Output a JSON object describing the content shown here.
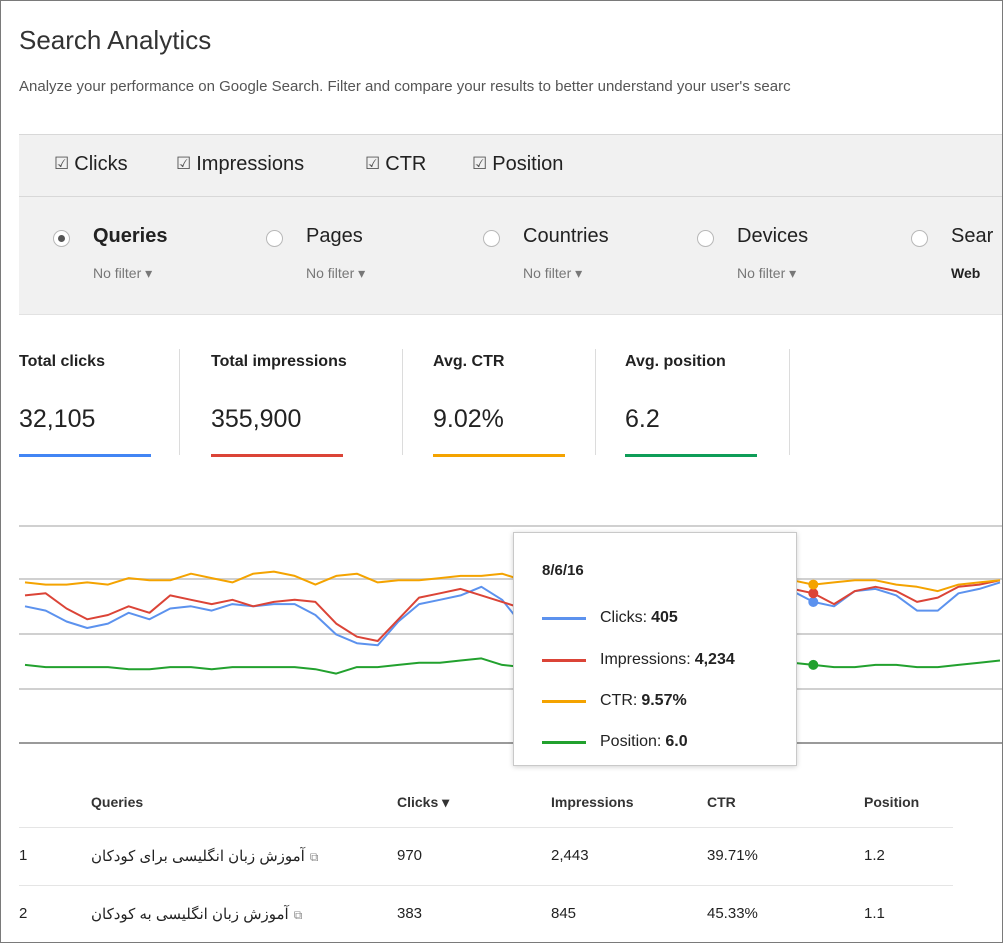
{
  "header": {
    "title": "Search Analytics",
    "description": "Analyze your performance on Google Search. Filter and compare your results to better understand your user's searc"
  },
  "metrics": [
    {
      "label": "Clicks",
      "checked": true
    },
    {
      "label": "Impressions",
      "checked": true
    },
    {
      "label": "CTR",
      "checked": true
    },
    {
      "label": "Position",
      "checked": true
    }
  ],
  "check_glyph": "☑",
  "groups": [
    {
      "label": "Queries",
      "filter": "No filter ▾",
      "selected": true
    },
    {
      "label": "Pages",
      "filter": "No filter ▾",
      "selected": false
    },
    {
      "label": "Countries",
      "filter": "No filter ▾",
      "selected": false
    },
    {
      "label": "Devices",
      "filter": "No filter ▾",
      "selected": false
    },
    {
      "label": "Sear",
      "filter": "Web",
      "selected": false
    }
  ],
  "totals": [
    {
      "label": "Total clicks",
      "value": "32,105",
      "color": "#4285f4"
    },
    {
      "label": "Total impressions",
      "value": "355,900",
      "color": "#db4437"
    },
    {
      "label": "Avg. CTR",
      "value": "9.02%",
      "color": "#f4a300"
    },
    {
      "label": "Avg. position",
      "value": "6.2",
      "color": "#0f9d58"
    }
  ],
  "chart_data": {
    "type": "line",
    "series": [
      {
        "name": "Clicks",
        "color": "#5c92ee",
        "values": [
          63,
          61,
          56,
          53,
          55,
          60,
          57,
          62,
          63,
          61,
          64,
          63,
          64,
          64,
          59,
          50,
          46,
          45,
          56,
          64,
          66,
          68,
          72,
          66,
          54,
          67,
          68,
          66,
          63,
          69,
          70,
          67,
          65,
          57,
          60,
          66,
          68,
          70,
          65,
          63,
          70,
          71,
          68,
          61,
          61,
          69,
          71,
          74
        ]
      },
      {
        "name": "Impressions",
        "color": "#db4437",
        "values": [
          68,
          69,
          62,
          57,
          59,
          63,
          60,
          68,
          66,
          64,
          66,
          63,
          65,
          66,
          65,
          55,
          49,
          47,
          57,
          67,
          69,
          71,
          68,
          65,
          62,
          68,
          69,
          68,
          65,
          72,
          71,
          69,
          67,
          63,
          66,
          69,
          72,
          71,
          69,
          64,
          70,
          72,
          70,
          65,
          67,
          72,
          73,
          75
        ]
      },
      {
        "name": "CTR",
        "color": "#f4a300",
        "values": [
          74,
          73,
          73,
          74,
          73,
          76,
          75,
          75,
          78,
          76,
          74,
          78,
          79,
          77,
          73,
          77,
          78,
          74,
          75,
          75,
          76,
          77,
          77,
          78,
          75,
          70,
          72,
          74,
          73,
          75,
          73,
          74,
          74,
          71,
          73,
          75,
          76,
          75,
          73,
          74,
          75,
          75,
          73,
          72,
          70,
          73,
          74,
          75
        ]
      },
      {
        "name": "Position",
        "color": "#22a12e",
        "values": [
          36,
          35,
          35,
          35,
          35,
          34,
          34,
          35,
          35,
          34,
          35,
          35,
          35,
          35,
          34,
          32,
          35,
          35,
          36,
          37,
          37,
          38,
          39,
          36,
          35,
          35,
          36,
          36,
          36,
          37,
          37,
          37,
          37,
          35,
          35,
          36,
          37,
          37,
          36,
          35,
          35,
          36,
          36,
          35,
          35,
          36,
          37,
          38
        ]
      }
    ],
    "grid": true,
    "tooltip": {
      "date": "8/6/16",
      "rows": [
        {
          "label": "Clicks:",
          "value": "405",
          "color": "#5c92ee"
        },
        {
          "label": "Impressions:",
          "value": "4,234",
          "color": "#db4437"
        },
        {
          "label": "CTR:",
          "value": "9.57%",
          "color": "#f4a300"
        },
        {
          "label": "Position:",
          "value": "6.0",
          "color": "#22a12e"
        }
      ]
    }
  },
  "table": {
    "headers": {
      "queries": "Queries",
      "clicks": "Clicks ▾",
      "impressions": "Impressions",
      "ctr": "CTR",
      "position": "Position"
    },
    "rows": [
      {
        "index": "1",
        "query": "آموزش زبان انگلیسی برای کودکان",
        "clicks": "970",
        "impressions": "2,443",
        "ctr": "39.71%",
        "position": "1.2"
      },
      {
        "index": "2",
        "query": "آموزش زبان انگلیسی به کودکان",
        "clicks": "383",
        "impressions": "845",
        "ctr": "45.33%",
        "position": "1.1"
      }
    ]
  }
}
